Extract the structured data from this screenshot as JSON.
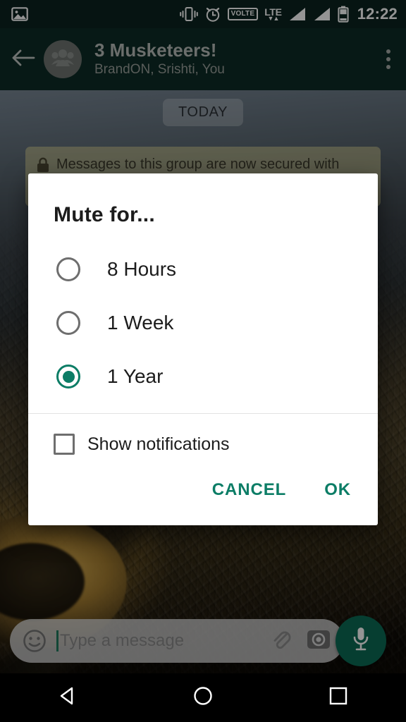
{
  "statusbar": {
    "time": "12:22",
    "icons": [
      "photo-icon",
      "vibrate-icon",
      "alarm-icon",
      "volte-icon",
      "lte-icon",
      "signal-icon",
      "signal-icon-2",
      "battery-icon"
    ],
    "volte_label": "VOLTE",
    "lte_label": "LTE",
    "data_arrows": "▼▲"
  },
  "appbar": {
    "back_icon": "back-arrow-icon",
    "avatar_icon": "group-avatar-icon",
    "title": "3 Musketeers!",
    "subtitle": "BrandON, Srishti, You",
    "overflow_icon": "overflow-menu-icon"
  },
  "chat": {
    "day_divider": "TODAY",
    "encryption_notice": "Messages to this group are now secured with",
    "lock_icon": "lock-icon"
  },
  "composer": {
    "emoji_icon": "emoji-icon",
    "placeholder": "Type a message",
    "value": "",
    "attach_icon": "paperclip-icon",
    "camera_icon": "camera-icon",
    "mic_icon": "microphone-icon"
  },
  "dialog": {
    "title": "Mute for...",
    "options": [
      {
        "label": "8 Hours",
        "selected": false
      },
      {
        "label": "1 Week",
        "selected": false
      },
      {
        "label": "1 Year",
        "selected": true
      }
    ],
    "checkbox": {
      "label": "Show notifications",
      "checked": false
    },
    "cancel_label": "CANCEL",
    "ok_label": "OK"
  },
  "navbar": {
    "back_icon": "nav-back-triangle-icon",
    "home_icon": "nav-home-circle-icon",
    "recents_icon": "nav-recents-square-icon"
  },
  "colors": {
    "accent": "#0c7d66",
    "appbar": "#0d2c26",
    "statusbar": "#0b2420",
    "dialog_bg": "#ffffff",
    "radio_unselected": "#6e6e6e"
  }
}
